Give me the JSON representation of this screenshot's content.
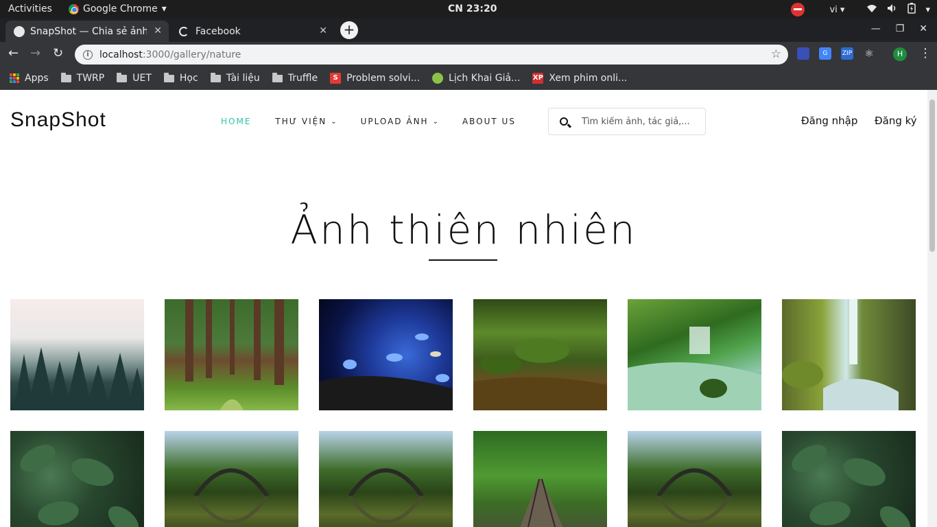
{
  "os": {
    "activities": "Activities",
    "app_name": "Google Chrome",
    "clock": "CN 23:20",
    "lang": "vi"
  },
  "tabs": [
    {
      "title": "SnapShot — Chia sẻ ảnh đẹp",
      "active": true
    },
    {
      "title": "Facebook",
      "active": false
    }
  ],
  "omnibox": {
    "host": "localhost",
    "path": ":3000/gallery/nature"
  },
  "profile_initial": "H",
  "bookmarks": [
    {
      "label": "Apps",
      "icon": "apps-grid-icon"
    },
    {
      "label": "TWRP",
      "icon": "folder-icon"
    },
    {
      "label": "UET",
      "icon": "folder-icon"
    },
    {
      "label": "Học",
      "icon": "folder-icon"
    },
    {
      "label": "Tài liệu",
      "icon": "folder-icon"
    },
    {
      "label": "Truffle",
      "icon": "folder-icon"
    },
    {
      "label": "Problem solvi...",
      "icon": "site-favicon"
    },
    {
      "label": "Lịch Khai Giả...",
      "icon": "site-favicon"
    },
    {
      "label": "Xem phim onli...",
      "icon": "site-favicon"
    }
  ],
  "site": {
    "logo": "SnapShot",
    "nav": [
      {
        "label": "HOME",
        "active": true
      },
      {
        "label": "THƯ VIỆN",
        "dropdown": true
      },
      {
        "label": "UPLOAD ẢNH",
        "dropdown": true
      },
      {
        "label": "ABOUT US"
      }
    ],
    "search_placeholder": "Tìm kiếm ảnh, tác giả,...",
    "login": "Đăng nhập",
    "register": "Đăng ký",
    "heading": "Ảnh thiên nhiên",
    "accent": "#2ec4a6"
  },
  "gallery": [
    {
      "subject": "foggy pine forest"
    },
    {
      "subject": "tall tree forest path"
    },
    {
      "subject": "blue butterflies mushroom"
    },
    {
      "subject": "mossy forest stream"
    },
    {
      "subject": "green waterfall stream"
    },
    {
      "subject": "waterfall cliff"
    },
    {
      "subject": "wet green leaves"
    },
    {
      "subject": "stone arch bridge reflection"
    },
    {
      "subject": "stone arch bridge reflection"
    },
    {
      "subject": "railway through forest"
    },
    {
      "subject": "stone arch bridge reflection"
    },
    {
      "subject": "wet green leaves"
    }
  ]
}
